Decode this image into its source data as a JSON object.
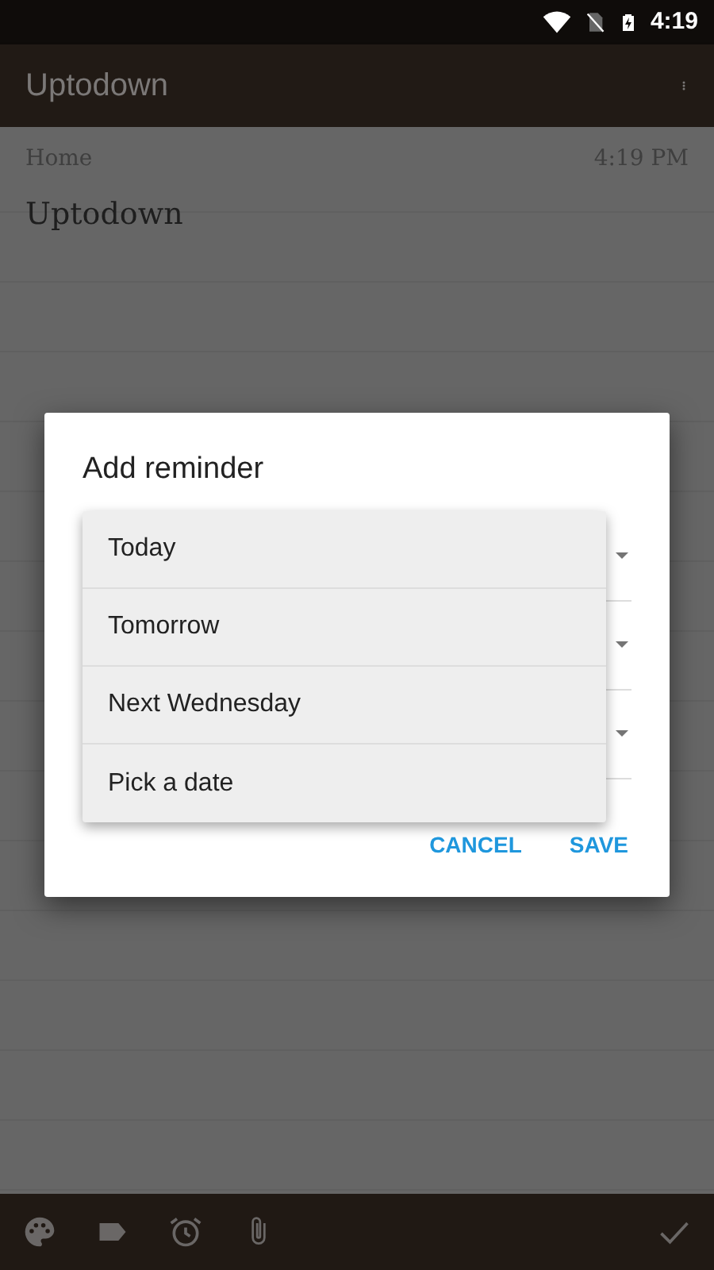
{
  "status_bar": {
    "time": "4:19"
  },
  "app_bar": {
    "title": "Uptodown"
  },
  "note": {
    "notebook": "Home",
    "time": "4:19 PM",
    "title": "Uptodown"
  },
  "dialog": {
    "title": "Add reminder",
    "menu": [
      "Today",
      "Tomorrow",
      "Next Wednesday",
      "Pick a date"
    ],
    "buttons": [
      "CANCEL",
      "SAVE"
    ]
  }
}
